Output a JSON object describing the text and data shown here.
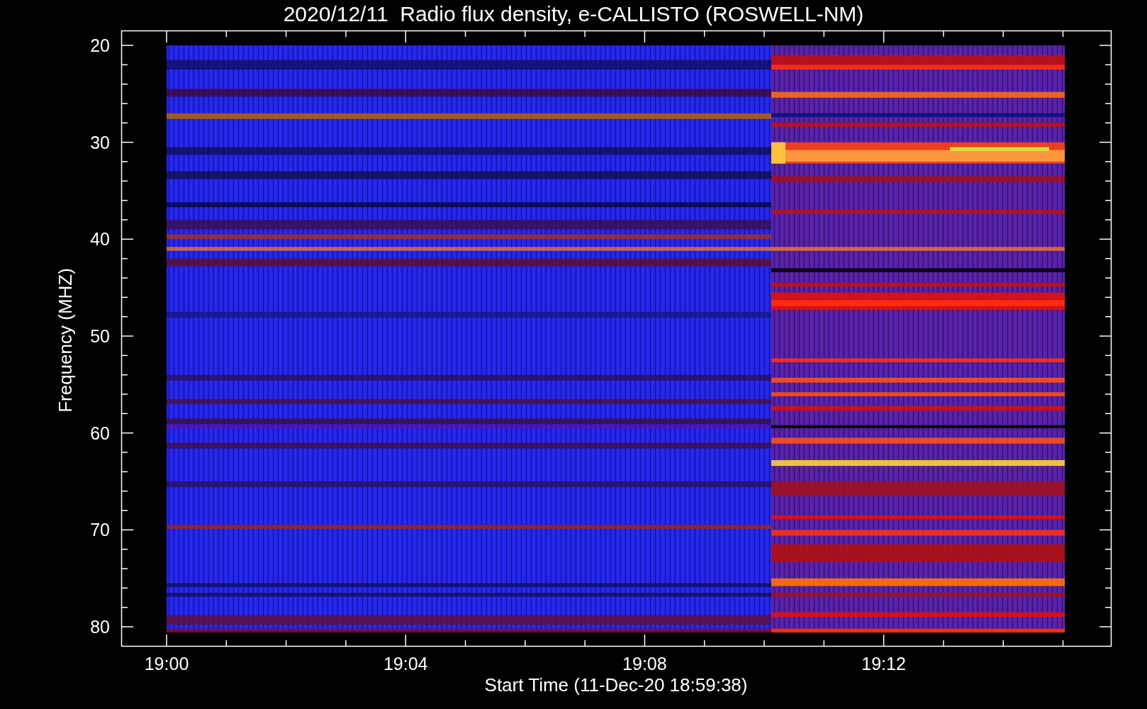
{
  "title": "2020/12/11  Radio flux density, e-CALLISTO (ROSWELL-NM)",
  "y_axis": {
    "title": "Frequency (MHZ)",
    "ticks": [
      "20",
      "30",
      "40",
      "50",
      "60",
      "70",
      "80"
    ]
  },
  "x_axis": {
    "title": "Start Time (11-Dec-20 18:59:38)",
    "ticks": [
      "19:00",
      "19:04",
      "19:08",
      "19:12"
    ]
  }
}
